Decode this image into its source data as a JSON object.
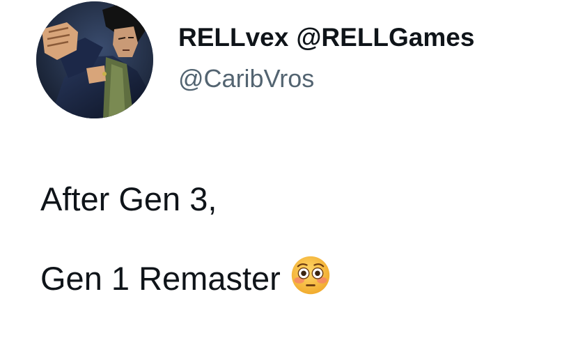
{
  "tweet": {
    "author": {
      "display_name": "RELLvex",
      "display_handle": "@RELLGames",
      "handle": "@CaribVros",
      "avatar_icon": "avatar-anime-character"
    },
    "lines": [
      "After Gen 3,",
      "Gen 1 Remaster"
    ],
    "emoji": "flushed-face-emoji"
  },
  "colors": {
    "text_primary": "#0f1419",
    "text_secondary": "#536471",
    "background": "#ffffff"
  }
}
